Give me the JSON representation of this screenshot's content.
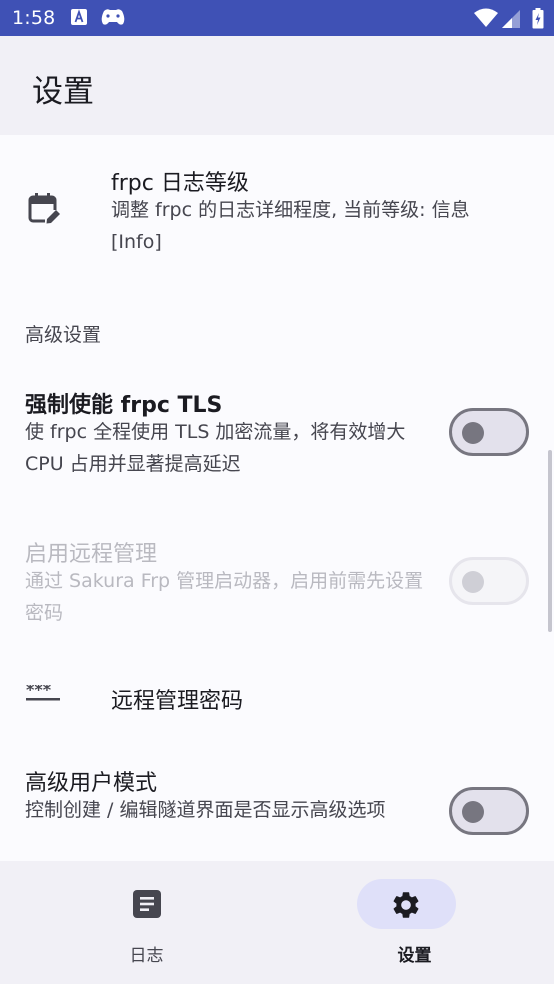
{
  "status_bar": {
    "time": "1:58",
    "icons": [
      "translate-notification-icon",
      "gamepad-notification-icon",
      "wifi-icon",
      "signal-icon",
      "battery-icon"
    ]
  },
  "app_bar": {
    "title": "设置"
  },
  "settings": {
    "log_level": {
      "title": "frpc 日志等级",
      "summary": "调整 frpc 的日志详细程度, 当前等级: 信息 [Info]",
      "icon": "calendar-edit-icon"
    },
    "advanced_section": {
      "header": "高级设置"
    },
    "force_tls": {
      "title": "强制使能 frpc TLS",
      "summary": "使 frpc 全程使用 TLS 加密流量，将有效增大 CPU 占用并显著提高延迟",
      "enabled": false
    },
    "remote_management": {
      "title": "启用远程管理",
      "summary": "通过 Sakura Frp 管理启动器，启用前需先设置密码",
      "enabled": false,
      "disabled": true
    },
    "remote_password": {
      "title": "远程管理密码",
      "icon": "password-icon"
    },
    "advanced_mode": {
      "title": "高级用户模式",
      "summary": "控制创建 / 编辑隧道界面是否显示高级选项",
      "enabled": false
    }
  },
  "bottom_nav": {
    "items": [
      {
        "label": "日志",
        "icon": "article-icon",
        "active": false
      },
      {
        "label": "设置",
        "icon": "gear-icon",
        "active": true
      }
    ]
  },
  "colors": {
    "status_bar": "#3f51b5",
    "app_bar": "#f1f0f6",
    "content_bg": "#fbfbfe",
    "active_nav_indicator": "#dfe0f9",
    "switch_track": "#e3e1ec",
    "switch_outline": "#777680"
  }
}
